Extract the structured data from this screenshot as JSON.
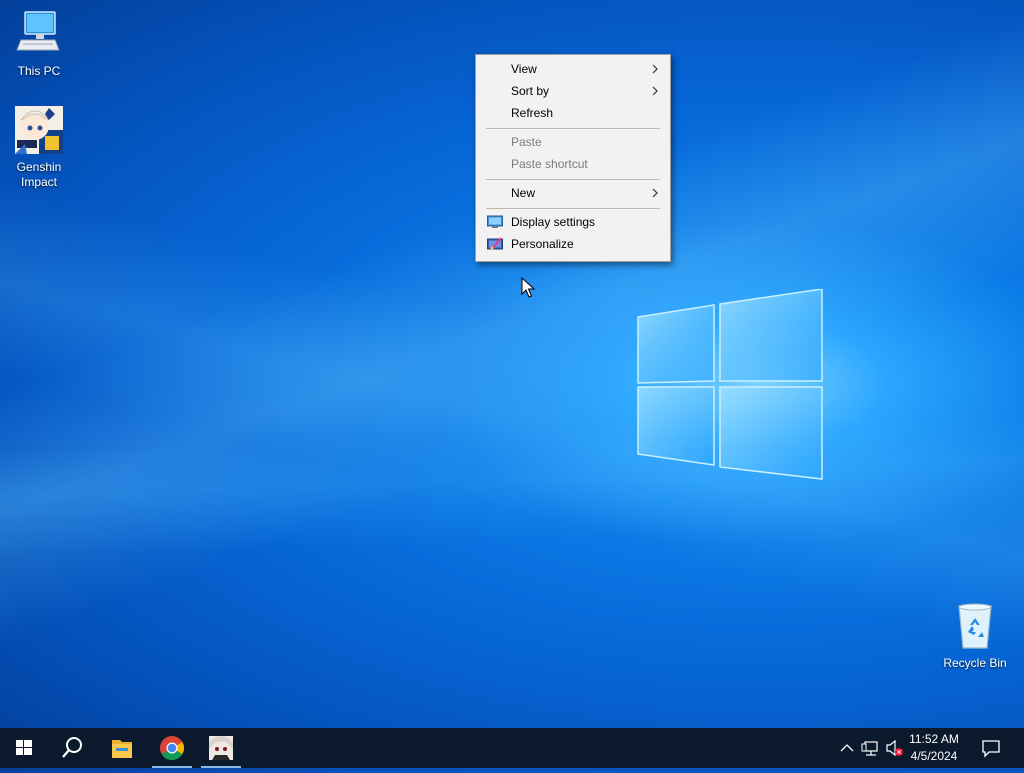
{
  "desktop": {
    "icons": [
      {
        "label": "This PC",
        "icon": "this-pc-icon"
      },
      {
        "label_line1": "Genshin",
        "label_line2": "Impact",
        "icon": "genshin-impact-icon"
      },
      {
        "label": "Recycle Bin",
        "icon": "recycle-bin-icon"
      }
    ]
  },
  "context_menu": {
    "items": [
      {
        "label": "View",
        "submenu": true,
        "enabled": true
      },
      {
        "label": "Sort by",
        "submenu": true,
        "enabled": true
      },
      {
        "label": "Refresh",
        "submenu": false,
        "enabled": true
      },
      {
        "label": "Paste",
        "submenu": false,
        "enabled": false
      },
      {
        "label": "Paste shortcut",
        "submenu": false,
        "enabled": false
      },
      {
        "label": "New",
        "submenu": true,
        "enabled": true
      },
      {
        "label": "Display settings",
        "icon": "display-settings-icon",
        "enabled": true
      },
      {
        "label": "Personalize",
        "icon": "personalize-icon",
        "enabled": true
      }
    ]
  },
  "taskbar": {
    "apps": [
      "start-icon",
      "search-icon",
      "file-explorer-icon",
      "chrome-icon",
      "app-avatar-icon"
    ],
    "tray_icons": [
      "chevron-up-icon",
      "network-icon",
      "volume-muted-icon"
    ],
    "clock": {
      "time": "11:52 AM",
      "date": "4/5/2024"
    },
    "notification_icon": "action-center-icon"
  },
  "colors": {
    "taskbar": "#0a1a2c",
    "menu_bg": "#f2f2f2",
    "desktop_accent": "#0b7ae6"
  }
}
